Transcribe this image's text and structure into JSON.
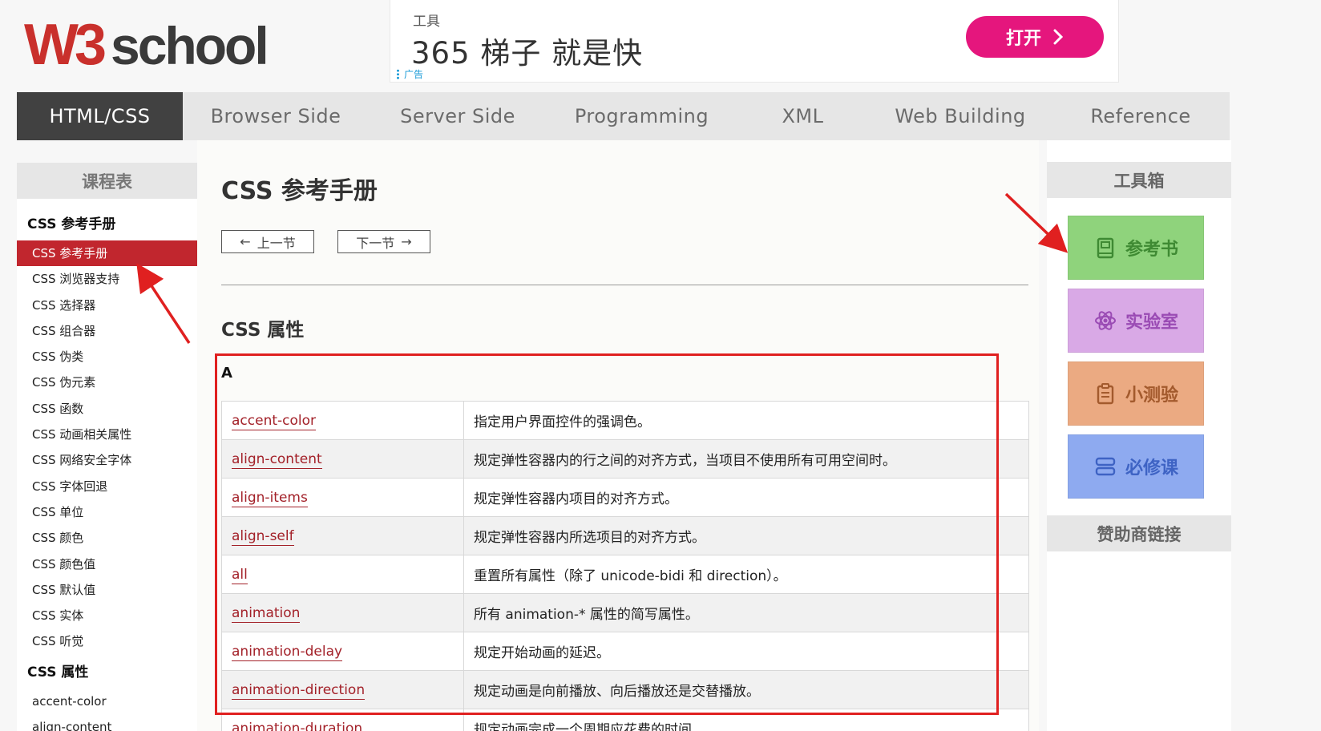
{
  "logo": {
    "text": "W3school"
  },
  "ad": {
    "tag": "工具",
    "title": "365 梯子 就是快",
    "button": "打开",
    "note": "广告"
  },
  "topnav": [
    "HTML/CSS",
    "Browser Side",
    "Server Side",
    "Programming",
    "XML",
    "Web Building",
    "Reference"
  ],
  "left_sidebar": {
    "heading": "课程表",
    "group1": "CSS 参考手册",
    "items": [
      "CSS 参考手册",
      "CSS 浏览器支持",
      "CSS 选择器",
      "CSS 组合器",
      "CSS 伪类",
      "CSS 伪元素",
      "CSS 函数",
      "CSS 动画相关属性",
      "CSS 网络安全字体",
      "CSS 字体回退",
      "CSS 单位",
      "CSS 颜色",
      "CSS 颜色值",
      "CSS 默认值",
      "CSS 实体",
      "CSS 听觉"
    ],
    "active_index": 0,
    "group2": "CSS 属性",
    "items2": [
      "accent-color",
      "align-content"
    ]
  },
  "main": {
    "title": "CSS 参考手册",
    "prev": "上一节",
    "next": "下一节",
    "section_title": "CSS 属性",
    "letter": "A",
    "rows": [
      {
        "prop": "accent-color",
        "desc": "指定用户界面控件的强调色。"
      },
      {
        "prop": "align-content",
        "desc": "规定弹性容器内的行之间的对齐方式，当项目不使用所有可用空间时。"
      },
      {
        "prop": "align-items",
        "desc": "规定弹性容器内项目的对齐方式。"
      },
      {
        "prop": "align-self",
        "desc": "规定弹性容器内所选项目的对齐方式。"
      },
      {
        "prop": "all",
        "desc": "重置所有属性（除了 unicode-bidi 和 direction）。"
      },
      {
        "prop": "animation",
        "desc": "所有 animation-* 属性的简写属性。"
      },
      {
        "prop": "animation-delay",
        "desc": "规定开始动画的延迟。"
      },
      {
        "prop": "animation-direction",
        "desc": "规定动画是向前播放、向后播放还是交替播放。"
      },
      {
        "prop": "animation-duration",
        "desc": "规定动画完成一个周期应花费的时间。"
      }
    ]
  },
  "toolbox": {
    "heading": "工具箱",
    "tools": [
      {
        "label": "参考书",
        "icon": "book-icon",
        "bg": "#8fd37c",
        "fg": "#3f8a33"
      },
      {
        "label": "实验室",
        "icon": "atom-icon",
        "bg": "#d9a9e6",
        "fg": "#9a4bb4"
      },
      {
        "label": "小测验",
        "icon": "clipboard-icon",
        "bg": "#ebaa82",
        "fg": "#a35a2d"
      },
      {
        "label": "必修课",
        "icon": "list-icon",
        "bg": "#8eaaf0",
        "fg": "#3e63c4"
      }
    ],
    "sponsor_heading": "赞助商链接"
  },
  "colors": {
    "accent": "#c1262e",
    "annotation_red": "#e02020"
  }
}
